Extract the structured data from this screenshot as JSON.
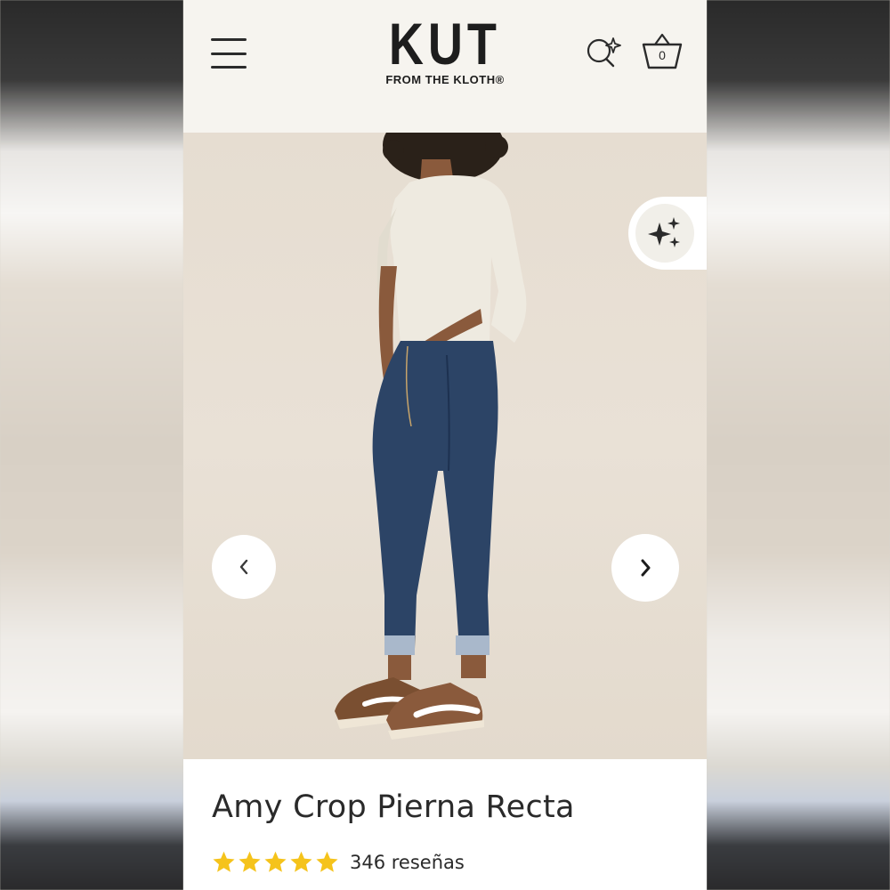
{
  "header": {
    "logo_main": "KUT",
    "logo_sub": "FROM THE KLOTH®",
    "cart_count": "0",
    "icons": [
      "menu-icon",
      "ai-search-icon",
      "cart-basket-icon"
    ]
  },
  "gallery": {
    "image_subject": "product-photo",
    "ai_icon": "sparkles-icon",
    "prev_icon": "chevron-left-icon",
    "next_icon": "chevron-right-icon"
  },
  "product": {
    "title": "Amy Crop Pierna Recta",
    "rating_value": 5,
    "rating_max": 5,
    "review_count_label": "346 reseñas",
    "star_color": "#f5c31b"
  },
  "colors": {
    "header_bg": "#f6f4ef",
    "text": "#2a2a2a",
    "denim": "#2c4466"
  }
}
